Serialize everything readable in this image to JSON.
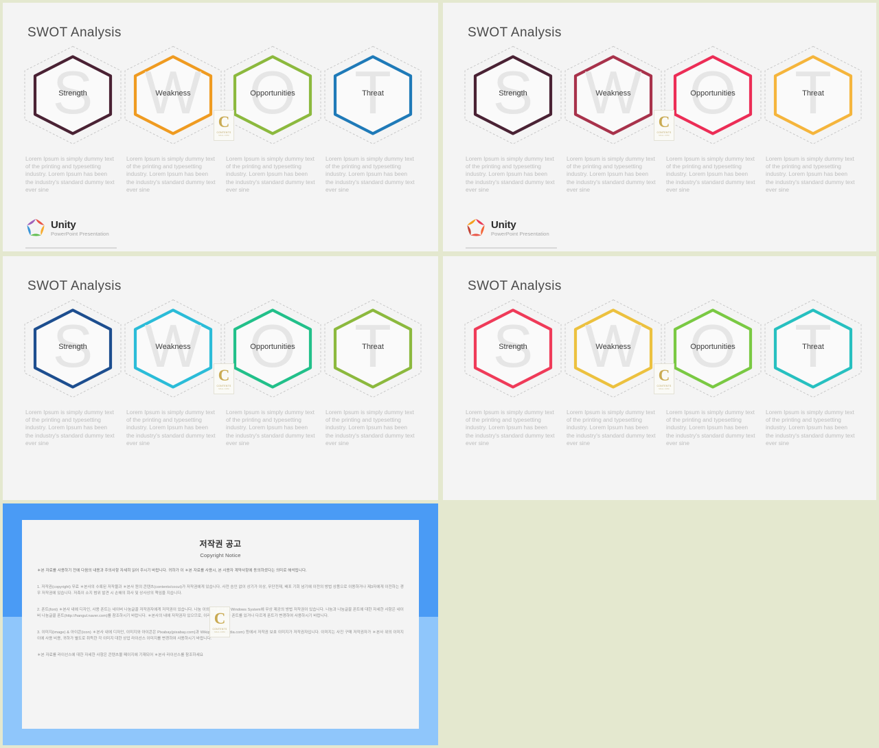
{
  "page": {
    "background_color": "#e4e8cf",
    "slide_background": "#f4f4f4"
  },
  "common": {
    "title": "SWOT Analysis",
    "body_text": "Lorem Ipsum is simply dummy text of the printing and typesetting industry. Lorem Ipsum has been the industry's standard dummy text ever sine",
    "logo_name": "Unity",
    "logo_sub": "PowerPoint Presentation",
    "watermark": {
      "letter": "C",
      "line1": "CONTENTS",
      "line2": "MALL.COM"
    },
    "items": [
      {
        "label": "Strength",
        "ghost": "S"
      },
      {
        "label": "Weakness",
        "ghost": "W"
      },
      {
        "label": "Opportunities",
        "ghost": "O"
      },
      {
        "label": "Threat",
        "ghost": "T"
      }
    ]
  },
  "slides": [
    {
      "id": "slide-1",
      "title": "SWOT Analysis",
      "colors": [
        "#4a2234",
        "#ef9b21",
        "#8cb93e",
        "#1f7ab8"
      ],
      "logo_colors": [
        "#e84c3d",
        "#f5a623",
        "#5aba47",
        "#2f8fd6",
        "#9b59b6"
      ]
    },
    {
      "id": "slide-2",
      "title": "SWOT Analysis",
      "colors": [
        "#4a2234",
        "#a8324b",
        "#ec2d56",
        "#f5b53c"
      ],
      "logo_colors": [
        "#e8314e",
        "#f25c2b",
        "#e84c3d",
        "#c0392b",
        "#f39c12"
      ]
    },
    {
      "id": "slide-3",
      "title": "SWOT Analysis",
      "colors": [
        "#1d4e8f",
        "#2bbcd8",
        "#22c08a",
        "#8cb93e"
      ],
      "logo_colors": [
        "#2f8fd6",
        "#27c2b0",
        "#5aba47",
        "#1d4e8f",
        "#2bbcd8"
      ]
    },
    {
      "id": "slide-4",
      "title": "SWOT Analysis",
      "colors": [
        "#ef3b59",
        "#ecc13f",
        "#7ac943",
        "#27c0c0"
      ],
      "logo_colors": [
        "#e84c3d",
        "#f5a623",
        "#5aba47",
        "#27c2b0",
        "#f39c12"
      ]
    }
  ],
  "copyright_slide": {
    "frame_color_top": "#4a9bf5",
    "frame_color_bottom": "#8fc6fb",
    "title": "저작권 공고",
    "subtitle": "Copyright Notice",
    "paragraphs": [
      "＊본 자료를 사용하기 전에 다음의 내용과 주의사항 자세히 읽어 주시기 바랍니다. 귀하가 이 ＊본 자료를 사용시, 본 사용자 계약사항에 동의하셨다는 의미로 해석됩니다.",
      "1. 저작권(copyright) 무료 ＊본사의 수록된 저작물과 ＊본사 원의 콘텐츠(contents/cocut)가 저작권에게 있습니다. 사전 승인 없이 상기가 이상, 무단전재, 배포 기회 넘기에 이전의 방법 상품으로 이용하거나 제3자에게 이전하는 경우 저작권에 있습니다. 저촉이 소지 범위 발견 시 손해의 회사 및 상사상의 책임을 지습니다.",
      "2. 폰트(font) ＊본사 내에 디자인, 사용 폰트는 네이버 나눔글꼴 저작권자에게 저작권이 있습니다. 나눔 이외 무료 폰트는 Windows System에 무상 제공의 방법 저작권이 있습니다. 나눔과 나눔글꼴 폰트에 대한 자세한 사항은 네이버 나눔글꼴 폰트(http://hangul.naver.com)를 참조하시기 바랍니다. ＊본사의 내에 저작권자 있으므로, 이러한 경우 전용 폰트를 있거나 다르게 폰트가 변경하여 사용하시기 바랍니다.",
      "3. 이미지(image) & 아이콘(icon) ＊본사 내에 디자인, 이미지와 아이콘은 Pixabay(pixabay.com)과 Wikipedia(wikipedia.com) 등에서 저작권 보호 이미지가 저작권자입니다. 이미지는 사진 구매 저작권자가 ＊본사 위의 이미지 이에 사용 비용, 귀하가 별도로 취득한 각 이미지 대한 상업 라이선스 이미지를 변경하여 사용하시기 바랍니다.",
      "＊본 자료를 라이선스에 대한 자세한 사항은 콘텐츠몰 페이지에 기재되어 ＊본사 라이선스를 참조하세요"
    ],
    "watermark": {
      "letter": "C",
      "line1": "CONTENTS",
      "line2": "MALL.COM"
    }
  }
}
